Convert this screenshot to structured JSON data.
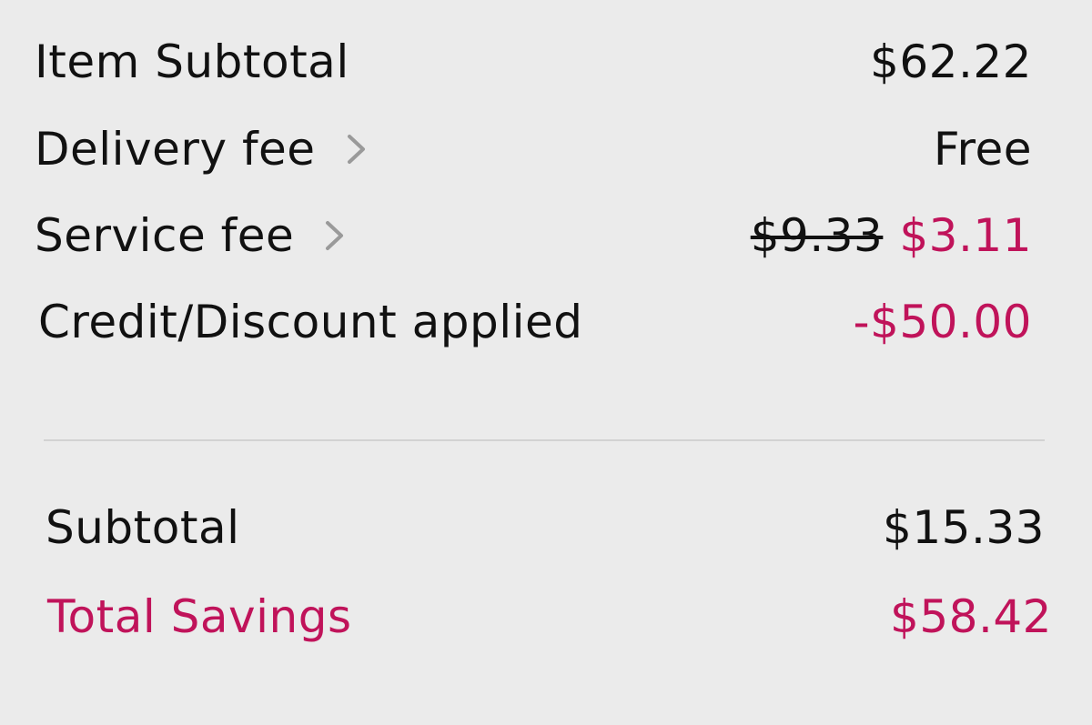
{
  "summary": {
    "item_subtotal": {
      "label": "Item Subtotal",
      "value": "$62.22"
    },
    "delivery_fee": {
      "label": "Delivery fee",
      "value": "Free",
      "icon": "chevron-right-icon"
    },
    "service_fee": {
      "label": "Service fee",
      "original_value": "$9.33",
      "value": "$3.11",
      "icon": "chevron-right-icon"
    },
    "credit_discount": {
      "label": "Credit/Discount applied",
      "value": "-$50.00"
    },
    "subtotal": {
      "label": "Subtotal",
      "value": "$15.33"
    },
    "total_savings": {
      "label": "Total Savings",
      "value": "$58.42"
    }
  },
  "colors": {
    "accent": "#c0135a",
    "text": "#111111",
    "background": "#ebebeb",
    "divider": "#d2d2d2",
    "chevron": "#9a9a9a"
  }
}
